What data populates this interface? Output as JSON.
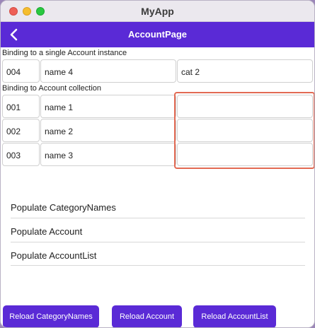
{
  "window": {
    "app_title": "MyApp"
  },
  "navbar": {
    "page_title": "AccountPage"
  },
  "single_section": {
    "label": "Binding to a single Account instance",
    "row": {
      "id": "004",
      "name": "name 4",
      "category": "cat 2"
    }
  },
  "collection_section": {
    "label": "Binding to Account collection",
    "rows": [
      {
        "id": "001",
        "name": "name 1",
        "category": ""
      },
      {
        "id": "002",
        "name": "name 2",
        "category": ""
      },
      {
        "id": "003",
        "name": "name 3",
        "category": ""
      }
    ]
  },
  "list": {
    "items": [
      {
        "label": "Populate CategoryNames"
      },
      {
        "label": "Populate Account"
      },
      {
        "label": "Populate AccountList"
      }
    ]
  },
  "buttons": {
    "reload_categories": "Reload CategoryNames",
    "reload_account": "Reload Account",
    "reload_account_list": "Reload AccountList"
  },
  "colors": {
    "accent": "#5a2ad6",
    "focus_border": "#e26a53"
  }
}
